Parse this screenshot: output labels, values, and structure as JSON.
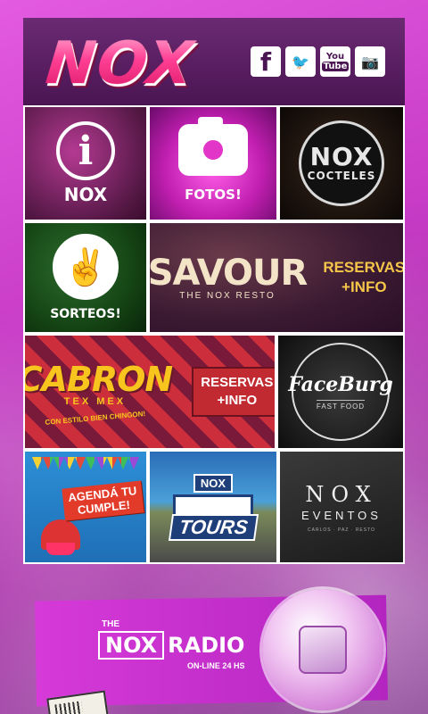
{
  "app": {
    "brand": "NOX",
    "colors": {
      "accent": "#d63ad8",
      "header": "#4a1552",
      "background": "#c83cc6"
    }
  },
  "social": [
    {
      "name": "facebook",
      "icon": "facebook-icon",
      "glyph": "f"
    },
    {
      "name": "twitter",
      "icon": "twitter-icon",
      "glyph": "🐦"
    },
    {
      "name": "youtube",
      "icon": "youtube-icon",
      "glyph_top": "You",
      "glyph_bottom": "Tube"
    },
    {
      "name": "instagram",
      "icon": "instagram-icon",
      "glyph": "📷"
    }
  ],
  "tiles": {
    "info": {
      "letter": "i",
      "label": "NOX"
    },
    "fotos": {
      "label": "FOTOS!"
    },
    "cocteles": {
      "big": "NOX",
      "small": "COCTELES"
    },
    "sorteos": {
      "label": "SORTEOS!"
    },
    "savour": {
      "title": "SAVOUR",
      "subtitle": "THE NOX RESTO",
      "cta_line1": "RESERVAS",
      "cta_line2": "+INFO"
    },
    "cabron": {
      "title": "CABRON",
      "sub": "TEX MEX",
      "tagline": "CON ESTILO BIEN CHINGON!",
      "cta_line1": "RESERVAS",
      "cta_line2": "+INFO"
    },
    "faceburg": {
      "title": "FaceBurg",
      "sub": "FAST FOOD"
    },
    "cumple": {
      "line1": "AGENDÁ TU",
      "line2": "CUMPLE!"
    },
    "tours": {
      "nox": "NOX",
      "word": "TOURS"
    },
    "eventos": {
      "nox": "NOX",
      "ev": "EVENTOS",
      "tiny": "CARLOS · PAZ · RESTO"
    }
  },
  "radio": {
    "the": "THE",
    "nox": "NOX",
    "word": "RADIO",
    "online": "ON-LINE 24 HS"
  }
}
